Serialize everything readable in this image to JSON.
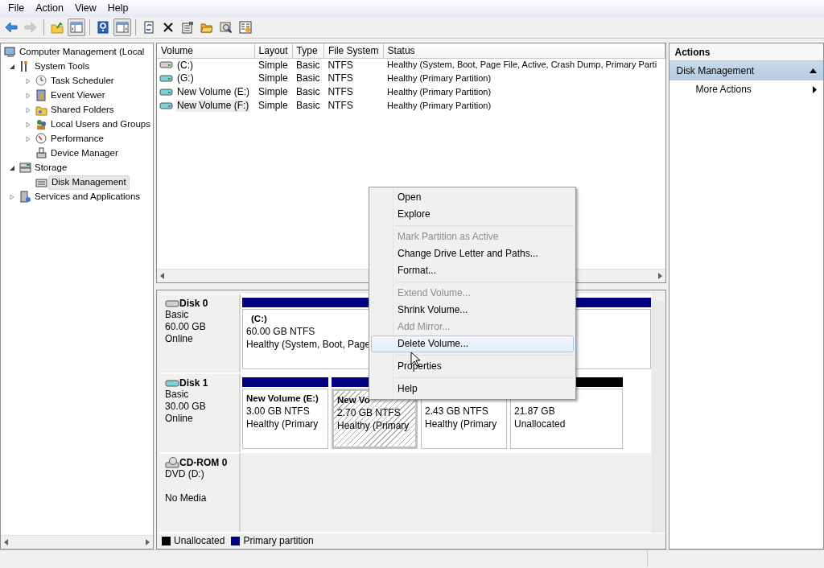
{
  "menu_bar": [
    "File",
    "Action",
    "View",
    "Help"
  ],
  "toolbar": [
    {
      "kind": "button",
      "pressed": false,
      "disabled": false
    },
    {
      "kind": "button",
      "pressed": false,
      "disabled": true
    },
    {
      "kind": "separator"
    },
    {
      "kind": "button",
      "pressed": false,
      "disabled": false
    },
    {
      "kind": "button",
      "pressed": true,
      "disabled": false
    },
    {
      "kind": "separator"
    },
    {
      "kind": "button",
      "pressed": false,
      "disabled": false
    },
    {
      "kind": "button",
      "pressed": true,
      "disabled": false
    },
    {
      "kind": "separator"
    },
    {
      "kind": "button",
      "pressed": false,
      "disabled": false
    },
    {
      "kind": "button",
      "pressed": false,
      "disabled": false
    },
    {
      "kind": "button",
      "pressed": false,
      "disabled": false
    },
    {
      "kind": "button",
      "pressed": false,
      "disabled": false
    },
    {
      "kind": "button",
      "pressed": false,
      "disabled": false
    },
    {
      "kind": "button",
      "pressed": false,
      "disabled": false
    }
  ],
  "tree": [
    {
      "kind": "root",
      "label": "Computer Management (Local",
      "selected": false,
      "children": [
        {
          "kind": "branch",
          "label": "System Tools",
          "expanded": true,
          "selected": false,
          "children": [
            {
              "kind": "branch",
              "label": "Task Scheduler",
              "expanded": false,
              "selected": false
            },
            {
              "kind": "branch",
              "label": "Event Viewer",
              "expanded": false,
              "selected": false
            },
            {
              "kind": "branch",
              "label": "Shared Folders",
              "expanded": false,
              "selected": false
            },
            {
              "kind": "branch",
              "label": "Local Users and Groups",
              "expanded": false,
              "selected": false
            },
            {
              "kind": "branch",
              "label": "Performance",
              "expanded": false,
              "selected": false
            },
            {
              "kind": "leaf",
              "label": "Device Manager",
              "selected": false
            }
          ]
        },
        {
          "kind": "branch",
          "label": "Storage",
          "expanded": true,
          "selected": false,
          "children": [
            {
              "kind": "leaf",
              "label": "Disk Management",
              "selected": true
            }
          ]
        },
        {
          "kind": "branch",
          "label": "Services and Applications",
          "expanded": false,
          "selected": false
        }
      ]
    }
  ],
  "volume_table": {
    "columns": [
      "Volume",
      "Layout",
      "Type",
      "File System",
      "Status"
    ],
    "rows": [
      {
        "kind": "system",
        "volume": "(C:)",
        "layout": "Simple",
        "type": "Basic",
        "file_system": "NTFS",
        "status": "Healthy (System, Boot, Page File, Active, Crash Dump, Primary Parti",
        "selected": false
      },
      {
        "kind": "data",
        "volume": "(G:)",
        "layout": "Simple",
        "type": "Basic",
        "file_system": "NTFS",
        "status": "Healthy (Primary Partition)",
        "selected": false
      },
      {
        "kind": "data",
        "volume": "New Volume (E:)",
        "layout": "Simple",
        "type": "Basic",
        "file_system": "NTFS",
        "status": "Healthy (Primary Partition)",
        "selected": false
      },
      {
        "kind": "data",
        "volume": "New Volume (F:)",
        "layout": "Simple",
        "type": "Basic",
        "file_system": "NTFS",
        "status": "Healthy (Primary Partition)",
        "selected": true
      }
    ]
  },
  "disks": [
    {
      "kind": "system",
      "name": "Disk 0",
      "type": "Basic",
      "size": "60.00 GB",
      "status": "Online",
      "partitions": [
        {
          "kind": "primary",
          "title": "(C:)",
          "size": "60.00 GB NTFS",
          "status": "Healthy (System, Boot, Page",
          "selected": false
        }
      ]
    },
    {
      "kind": "data",
      "name": "Disk 1",
      "type": "Basic",
      "size": "30.00 GB",
      "status": "Online",
      "partitions": [
        {
          "kind": "primary",
          "title": "New Volume  (E:)",
          "size": "3.00 GB NTFS",
          "status": "Healthy (Primary",
          "selected": false
        },
        {
          "kind": "primary",
          "title": "New Vo",
          "size": "2.70 GB NTFS",
          "status": "Healthy (Primary",
          "selected": true
        },
        {
          "kind": "primary",
          "size": "2.43 GB NTFS",
          "status": "Healthy (Primary",
          "selected": false
        },
        {
          "kind": "unallocated",
          "size": "21.87 GB",
          "status": "Unallocated",
          "selected": false
        }
      ]
    },
    {
      "kind": "cdrom",
      "name": "CD-ROM 0",
      "type": "DVD (D:)",
      "status": "No Media"
    }
  ],
  "legend": [
    {
      "label": "Unallocated",
      "color": "#000000"
    },
    {
      "label": "Primary partition",
      "color": "#000080"
    }
  ],
  "actions": {
    "title": "Actions",
    "section": {
      "label": "Disk Management",
      "expanded": true
    },
    "items": [
      {
        "label": "More Actions"
      }
    ]
  },
  "context_menu": [
    {
      "kind": "item",
      "label": "Open",
      "disabled": false,
      "selected": false
    },
    {
      "kind": "item",
      "label": "Explore",
      "disabled": false,
      "selected": false
    },
    {
      "kind": "separator"
    },
    {
      "kind": "item",
      "label": "Mark Partition as Active",
      "disabled": true,
      "selected": false
    },
    {
      "kind": "item",
      "label": "Change Drive Letter and Paths...",
      "disabled": false,
      "selected": false
    },
    {
      "kind": "item",
      "label": "Format...",
      "disabled": false,
      "selected": false
    },
    {
      "kind": "separator"
    },
    {
      "kind": "item",
      "label": "Extend Volume...",
      "disabled": true,
      "selected": false
    },
    {
      "kind": "item",
      "label": "Shrink Volume...",
      "disabled": false,
      "selected": false
    },
    {
      "kind": "item",
      "label": "Add Mirror...",
      "disabled": true,
      "selected": false
    },
    {
      "kind": "item",
      "label": "Delete Volume...",
      "disabled": false,
      "selected": true
    },
    {
      "kind": "separator"
    },
    {
      "kind": "item",
      "label": "Properties",
      "disabled": false,
      "selected": false
    },
    {
      "kind": "separator"
    },
    {
      "kind": "item",
      "label": "Help",
      "disabled": false,
      "selected": false
    }
  ]
}
